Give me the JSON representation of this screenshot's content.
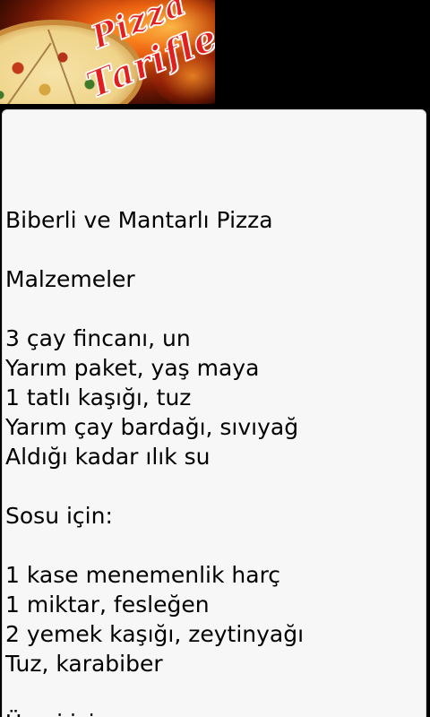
{
  "banner": {
    "title_line1": "Pizza",
    "title_line2": "Tarifleri"
  },
  "recipe": {
    "lines": [
      "Biberli ve Mantarlı Pizza",
      "",
      "Malzemeler",
      "",
      "3 çay fincanı, un",
      "Yarım paket, yaş maya",
      "1 tatlı kaşığı, tuz",
      "Yarım çay bardağı, sıvıyağ",
      "Aldığı kadar ılık su",
      "",
      "Sosu için:",
      "",
      "1 kase menemenlik harç",
      "1 miktar, fesleğen",
      "2 yemek kaşığı, zeytinyağı",
      "Tuz, karabiber",
      "",
      "Üzeri için:"
    ]
  }
}
